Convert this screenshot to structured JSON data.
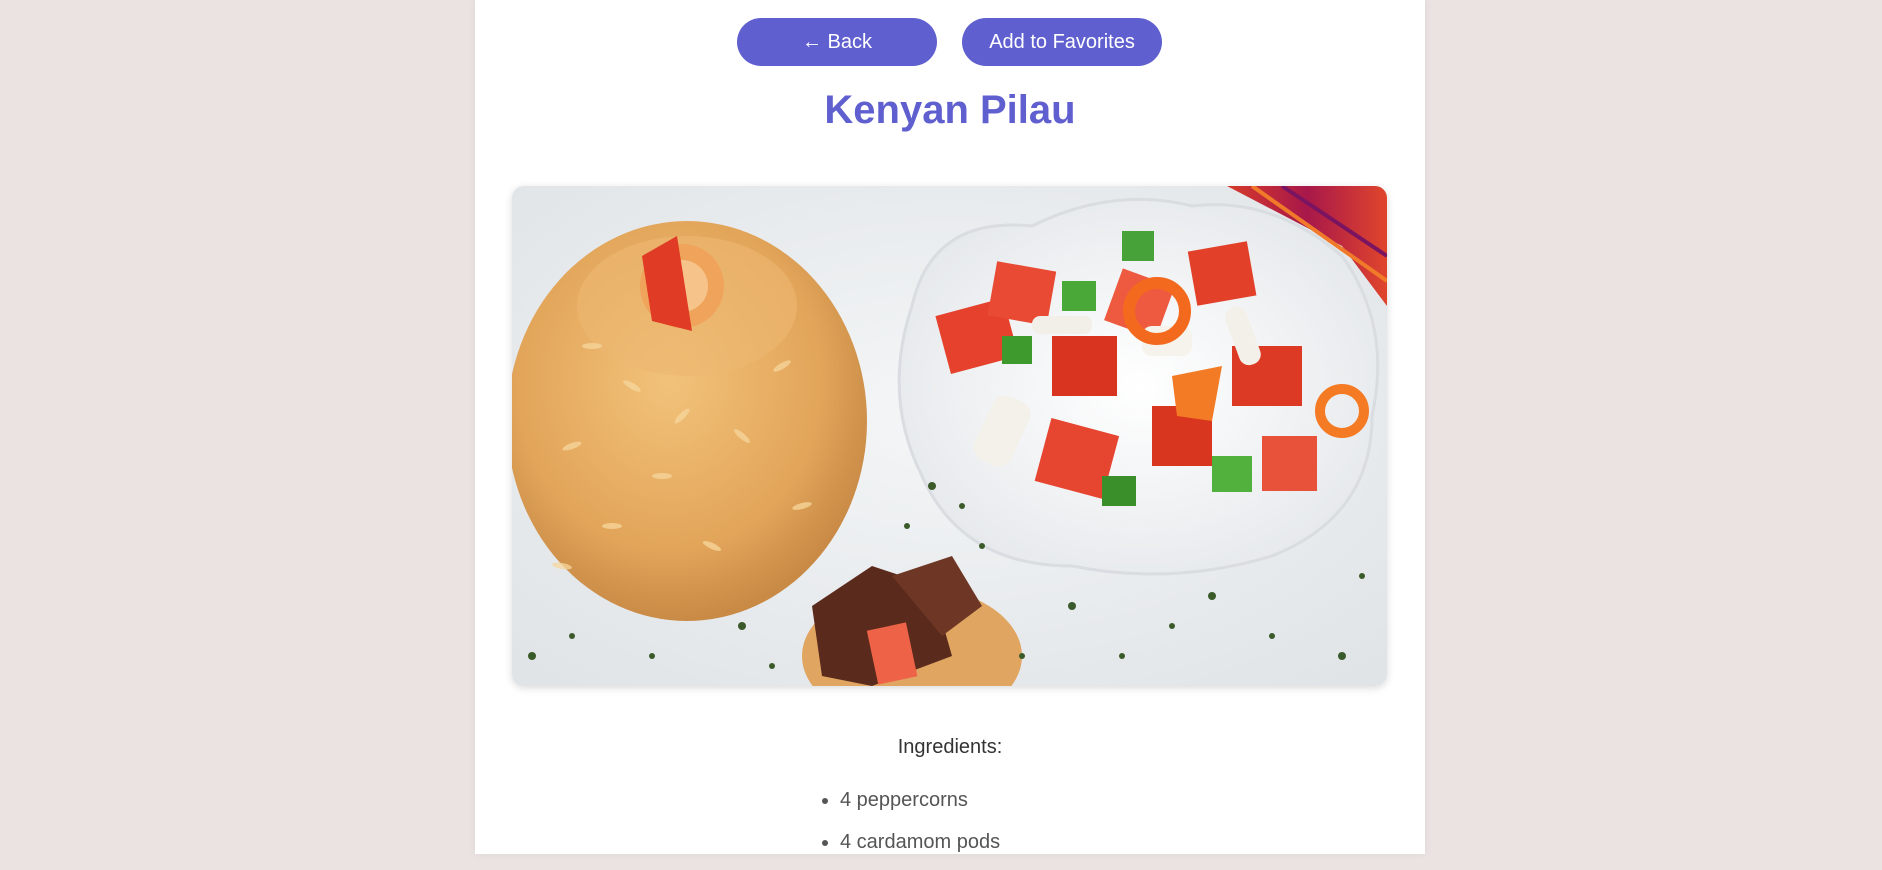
{
  "nav": {
    "back_label": "← Back",
    "favorites_label": "Add to Favorites"
  },
  "recipe": {
    "title": "Kenyan Pilau",
    "image_alt": "Kenyan Pilau"
  },
  "ingredients": {
    "heading": "Ingredients:",
    "items": [
      "4 peppercorns",
      "4 cardamom pods"
    ]
  },
  "colors": {
    "accent": "#5f5fcf",
    "background": "#ebe3e1",
    "card": "#ffffff"
  }
}
